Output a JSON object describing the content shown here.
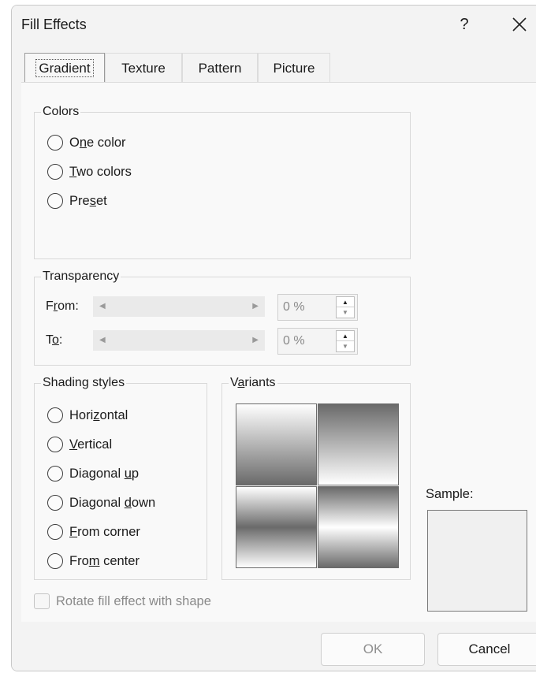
{
  "dialog": {
    "title": "Fill Effects",
    "help_label": "?",
    "close_icon": "close-icon"
  },
  "tabs": [
    {
      "label": "Gradient",
      "active": true
    },
    {
      "label": "Texture",
      "active": false
    },
    {
      "label": "Pattern",
      "active": false
    },
    {
      "label": "Picture",
      "active": false
    }
  ],
  "colors": {
    "legend": "Colors",
    "options": [
      {
        "pre": "O",
        "ul": "n",
        "post": "e color"
      },
      {
        "pre": "",
        "ul": "T",
        "post": "wo colors"
      },
      {
        "pre": "Pre",
        "ul": "s",
        "post": "et"
      }
    ]
  },
  "transparency": {
    "legend": "Transparency",
    "from": {
      "pre": "F",
      "ul": "r",
      "post": "om:",
      "value": "0 %"
    },
    "to": {
      "pre": "T",
      "ul": "o",
      "post": ":",
      "value": "0 %"
    }
  },
  "shading": {
    "legend": "Shading styles",
    "options": [
      {
        "pre": "Hori",
        "ul": "z",
        "post": "ontal"
      },
      {
        "pre": "",
        "ul": "V",
        "post": "ertical"
      },
      {
        "pre": "Diagonal ",
        "ul": "u",
        "post": "p"
      },
      {
        "pre": "Diagonal ",
        "ul": "d",
        "post": "own"
      },
      {
        "pre": "",
        "ul": "F",
        "post": "rom corner"
      },
      {
        "pre": "Fro",
        "ul": "m",
        "post": " center"
      }
    ]
  },
  "variants": {
    "legend_pre": "V",
    "legend_ul": "a",
    "legend_post": "riants"
  },
  "sample": {
    "label": "Sample:"
  },
  "rotate_checkbox": {
    "label": "Rotate fill effect with shape",
    "checked": false,
    "enabled": false
  },
  "buttons": {
    "ok": "OK",
    "cancel": "Cancel"
  }
}
